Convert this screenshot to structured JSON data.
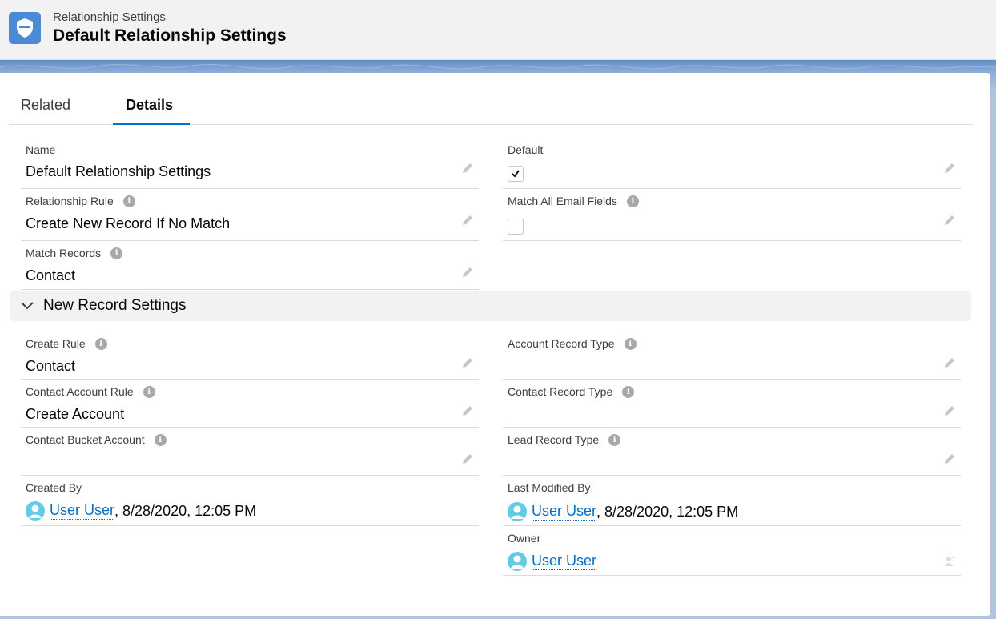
{
  "header": {
    "object_label": "Relationship Settings",
    "record_title": "Default Relationship Settings",
    "icon": "shield-icon"
  },
  "tabs": [
    {
      "label": "Related",
      "active": false
    },
    {
      "label": "Details",
      "active": true
    }
  ],
  "info_glyph": "i",
  "fields": {
    "name": {
      "label": "Name",
      "value": "Default Relationship Settings"
    },
    "default": {
      "label": "Default",
      "checked": true
    },
    "relationship_rule": {
      "label": "Relationship Rule",
      "value": "Create New Record If No Match"
    },
    "match_all_email": {
      "label": "Match All Email Fields",
      "checked": false
    },
    "match_records": {
      "label": "Match Records",
      "value": "Contact"
    }
  },
  "section": {
    "title": "New Record Settings",
    "expanded": true
  },
  "new_record": {
    "create_rule": {
      "label": "Create Rule",
      "value": "Contact"
    },
    "account_record_type": {
      "label": "Account Record Type",
      "value": ""
    },
    "contact_account_rule": {
      "label": "Contact Account Rule",
      "value": "Create Account"
    },
    "contact_record_type": {
      "label": "Contact Record Type",
      "value": ""
    },
    "contact_bucket_account": {
      "label": "Contact Bucket Account",
      "value": ""
    },
    "lead_record_type": {
      "label": "Lead Record Type",
      "value": ""
    }
  },
  "system": {
    "created_by": {
      "label": "Created By",
      "user": "User User",
      "timestamp": ", 8/28/2020, 12:05 PM"
    },
    "last_modified_by": {
      "label": "Last Modified By",
      "user": "User User",
      "timestamp": ", 8/28/2020, 12:05 PM"
    },
    "owner": {
      "label": "Owner",
      "user": "User User"
    }
  },
  "colors": {
    "brand_blue": "#0070d2",
    "link": "#006dcc",
    "object_icon": "#4b8ad6",
    "avatar": "#65cae4"
  }
}
